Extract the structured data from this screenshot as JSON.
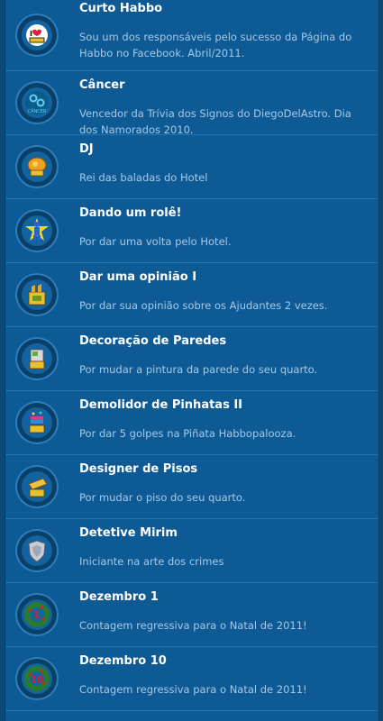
{
  "badges": [
    {
      "title": "Curto Habbo",
      "desc": "Sou um dos responsáveis pelo sucesso da Página do Habbo no Facebook. Abril/2011.",
      "icon": "like-badge-icon"
    },
    {
      "title": "Câncer",
      "desc": "Vencedor da Trívia dos Signos do DiegoDelAstro. Dia dos Namorados 2010.",
      "icon": "cancer-sign-icon",
      "icon_text": "CÂNCER"
    },
    {
      "title": "DJ",
      "desc": "Rei das baladas do Hotel",
      "icon": "dj-badge-icon"
    },
    {
      "title": "Dando um rolê!",
      "desc": "Por dar uma volta pelo Hotel.",
      "icon": "walker-badge-icon"
    },
    {
      "title": "Dar uma opinião I",
      "desc": "Por dar sua opinião sobre os Ajudantes 2 vezes.",
      "icon": "thumbs-up-badge-icon"
    },
    {
      "title": "Decoração de Paredes",
      "desc": "Por mudar a pintura da parede do seu quarto.",
      "icon": "paint-bucket-badge-icon"
    },
    {
      "title": "Demolidor de Pinhatas II",
      "desc": "Por dar 5 golpes na Piñata Habbopalooza.",
      "icon": "pinata-badge-icon"
    },
    {
      "title": "Designer de Pisos",
      "desc": "Por mudar o piso do seu quarto.",
      "icon": "floor-tile-badge-icon"
    },
    {
      "title": "Detetive Mirim",
      "desc": "Iniciante na arte dos crimes",
      "icon": "detective-shield-icon"
    },
    {
      "title": "Dezembro 1",
      "desc": "Contagem regressiva para o Natal de 2011!",
      "icon": "wreath-1-badge-icon",
      "icon_text": "1"
    },
    {
      "title": "Dezembro 10",
      "desc": "Contagem regressiva para o Natal de 2011!",
      "icon": "wreath-10-badge-icon",
      "icon_text": "10"
    }
  ]
}
